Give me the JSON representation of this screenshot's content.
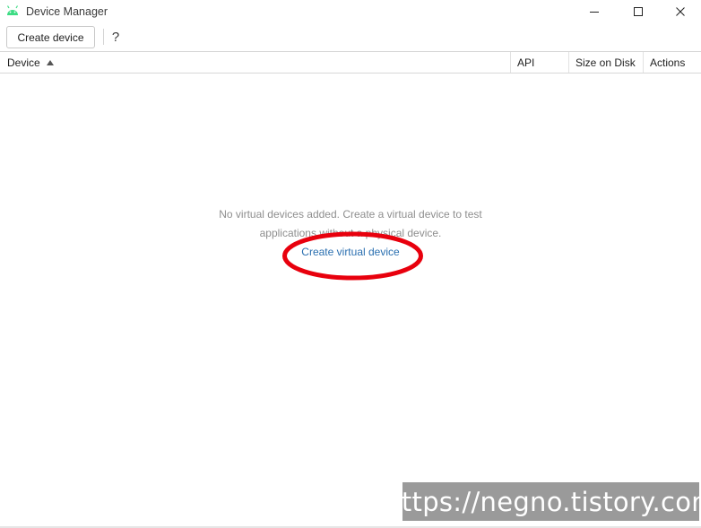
{
  "window": {
    "title": "Device Manager",
    "app_icon": "android-icon",
    "controls": [
      "minimize-icon",
      "maximize-icon",
      "close-icon"
    ]
  },
  "toolbar": {
    "create_device_label": "Create device",
    "help_label": "?"
  },
  "table": {
    "columns": [
      "Device",
      "API",
      "Size on Disk",
      "Actions"
    ],
    "sorted_column": "Device",
    "sort_direction": "ascending",
    "rows": []
  },
  "empty_state": {
    "message": "No virtual devices added. Create a virtual device to test applications without a physical device.",
    "link_label": "Create virtual device"
  },
  "annotation": {
    "shape": "ellipse",
    "color": "#e8000d"
  },
  "watermark": {
    "text": "https://negno.tistory.com"
  },
  "colors": {
    "android_green": "#3ddc84",
    "link_blue": "#2a6fb0",
    "muted_text": "#8e8e8e"
  }
}
